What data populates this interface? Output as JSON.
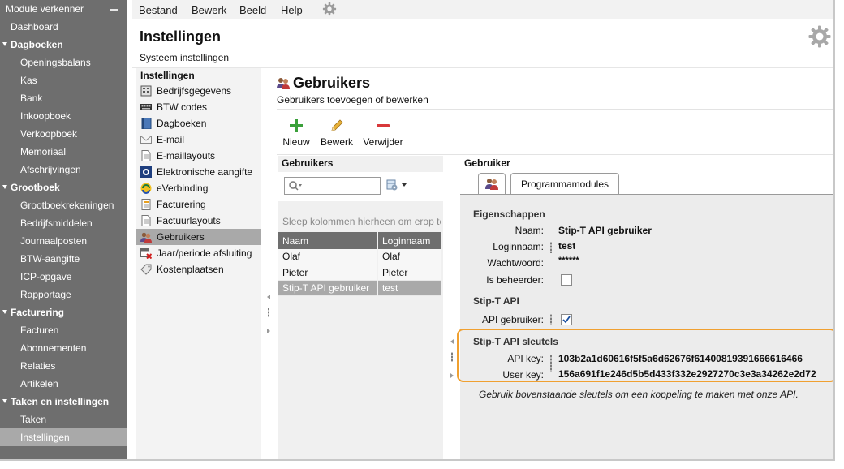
{
  "nav": {
    "header": "Module verkenner",
    "items": [
      {
        "label": "Dashboard",
        "kind": "top"
      },
      {
        "label": "Dagboeken",
        "kind": "group"
      },
      {
        "label": "Openingsbalans",
        "kind": "item"
      },
      {
        "label": "Kas",
        "kind": "item"
      },
      {
        "label": "Bank",
        "kind": "item"
      },
      {
        "label": "Inkoopboek",
        "kind": "item"
      },
      {
        "label": "Verkoopboek",
        "kind": "item"
      },
      {
        "label": "Memoriaal",
        "kind": "item"
      },
      {
        "label": "Afschrijvingen",
        "kind": "item"
      },
      {
        "label": "Grootboek",
        "kind": "group"
      },
      {
        "label": "Grootboekrekeningen",
        "kind": "item"
      },
      {
        "label": "Bedrijfsmiddelen",
        "kind": "item"
      },
      {
        "label": "Journaalposten",
        "kind": "item"
      },
      {
        "label": "BTW-aangifte",
        "kind": "item"
      },
      {
        "label": "ICP-opgave",
        "kind": "item"
      },
      {
        "label": "Rapportage",
        "kind": "item"
      },
      {
        "label": "Facturering",
        "kind": "group"
      },
      {
        "label": "Facturen",
        "kind": "item"
      },
      {
        "label": "Abonnementen",
        "kind": "item"
      },
      {
        "label": "Relaties",
        "kind": "item"
      },
      {
        "label": "Artikelen",
        "kind": "item"
      },
      {
        "label": "Taken en instellingen",
        "kind": "group"
      },
      {
        "label": "Taken",
        "kind": "item"
      },
      {
        "label": "Instellingen",
        "kind": "item",
        "active": true
      }
    ]
  },
  "menu": {
    "items": [
      "Bestand",
      "Bewerk",
      "Beeld",
      "Help"
    ],
    "gear_icon": "gear-icon"
  },
  "header": {
    "title": "Instellingen",
    "subtitle": "Systeem instellingen"
  },
  "settings": {
    "heading": "Instellingen",
    "items": [
      {
        "label": "Bedrijfsgegevens",
        "icon": "building-icon"
      },
      {
        "label": "BTW codes",
        "icon": "keyboard-icon"
      },
      {
        "label": "Dagboeken",
        "icon": "book-icon"
      },
      {
        "label": "E-mail",
        "icon": "envelope-icon"
      },
      {
        "label": "E-maillayouts",
        "icon": "document-icon"
      },
      {
        "label": "Elektronische aangifte",
        "icon": "tax-icon"
      },
      {
        "label": "eVerbinding",
        "icon": "connection-icon"
      },
      {
        "label": "Facturering",
        "icon": "invoice-icon"
      },
      {
        "label": "Factuurlayouts",
        "icon": "document-icon"
      },
      {
        "label": "Gebruikers",
        "icon": "users-icon",
        "active": true
      },
      {
        "label": "Jaar/periode afsluiting",
        "icon": "calendar-close-icon"
      },
      {
        "label": "Kostenplaatsen",
        "icon": "tag-icon"
      }
    ]
  },
  "main": {
    "title": "Gebruikers",
    "subtitle": "Gebruikers toevoegen of bewerken",
    "toolbar": {
      "new_label": "Nieuw",
      "edit_label": "Bewerk",
      "delete_label": "Verwijder"
    },
    "grid": {
      "heading": "Gebruikers",
      "search_placeholder": "",
      "group_hint": "Sleep kolommen hierheen om erop te groeperen",
      "columns": [
        "Naam",
        "Loginnaam"
      ],
      "rows": [
        [
          "Olaf",
          "Olaf"
        ],
        [
          "Pieter",
          "Pieter"
        ],
        [
          "Stip-T API gebruiker",
          "test"
        ]
      ],
      "selected_row": 2
    },
    "detail": {
      "heading": "Gebruiker",
      "tab_programmamodules": "Programmamodules",
      "eigenschappen": {
        "title": "Eigenschappen",
        "naam_label": "Naam:",
        "naam_value": "Stip-T API gebruiker",
        "login_label": "Loginnaam:",
        "login_value": "test",
        "password_label": "Wachtwoord:",
        "password_value": "******",
        "admin_label": "Is beheerder:",
        "admin_checked": false
      },
      "api": {
        "title": "Stip-T API",
        "api_user_label": "API gebruiker:",
        "api_user_checked": true
      },
      "keys": {
        "title": "Stip-T API sleutels",
        "api_key_label": "API key:",
        "api_key_value": "103b2a1d60616f5f5a6d62676f61400819391666616466",
        "user_key_label": "User key:",
        "user_key_value": "156a691f1e246d5b5d433f332e2927270c3e3a34262e2d72",
        "note": "Gebruik bovenstaande sleutels om een koppeling te maken met onze API."
      }
    }
  },
  "colors": {
    "nav_bg": "#6e6e6e",
    "active_bg": "#a9a9a9",
    "highlight": "#f0a030",
    "add_green": "#3aa03a",
    "delete_red": "#d8383a"
  }
}
